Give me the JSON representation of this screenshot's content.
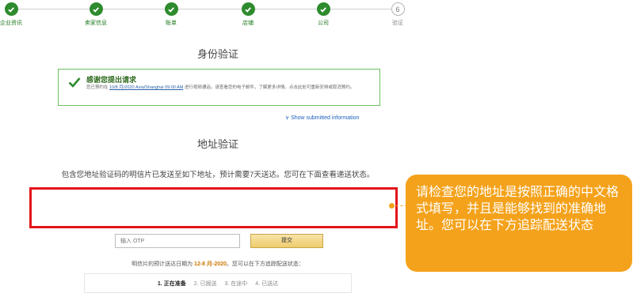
{
  "stepper": {
    "steps": [
      {
        "label": "企业资讯",
        "status": "done"
      },
      {
        "label": "卖家信息",
        "status": "done"
      },
      {
        "label": "账单",
        "status": "done"
      },
      {
        "label": "店铺",
        "status": "done"
      },
      {
        "label": "公司",
        "status": "done"
      },
      {
        "number": "6",
        "label": "验证",
        "status": "pending"
      }
    ],
    "colors": {
      "done": "#2e8b2e",
      "pending": "#b5b5b5"
    }
  },
  "identity": {
    "title": "身份验证",
    "notice_title": "感谢您提出请求",
    "notice_body_1": "您已预约在 ",
    "notice_date": "10/8 月/2020 Asia/Shanghai 09:00 AM",
    "notice_body_2": " 进行视频通话。请查看您的电子邮件，了解更多详情。点击此处可重新安排或取消预约。",
    "show_link": "∨ Show submitted information"
  },
  "address": {
    "title": "地址验证",
    "instruction": "包含您地址验证码的明信片已发送至如下地址，预计需要7天送达。您可在下面查看递送状态。",
    "otp_placeholder": "输入 OTP",
    "submit_label": "提交",
    "estimate_prefix": "明信片的预计送达日期为 ",
    "estimate_date": "12-8 月-2020",
    "estimate_suffix": "。您可以在下方追踪配送状态：",
    "tracking": [
      {
        "label": "1. 正在准备",
        "active": true
      },
      {
        "label": "2. 已掘送",
        "active": false
      },
      {
        "label": "3. 在途中",
        "active": false
      },
      {
        "label": "4. 已送达",
        "active": false
      }
    ]
  },
  "callout": {
    "text": "请检查您的地址是按照正确的中文格式填写，并且是能够找到的准确地址。您可以在下方追踪配送状态",
    "color": "#f4a21b"
  },
  "highlight_color": "#e3141b"
}
